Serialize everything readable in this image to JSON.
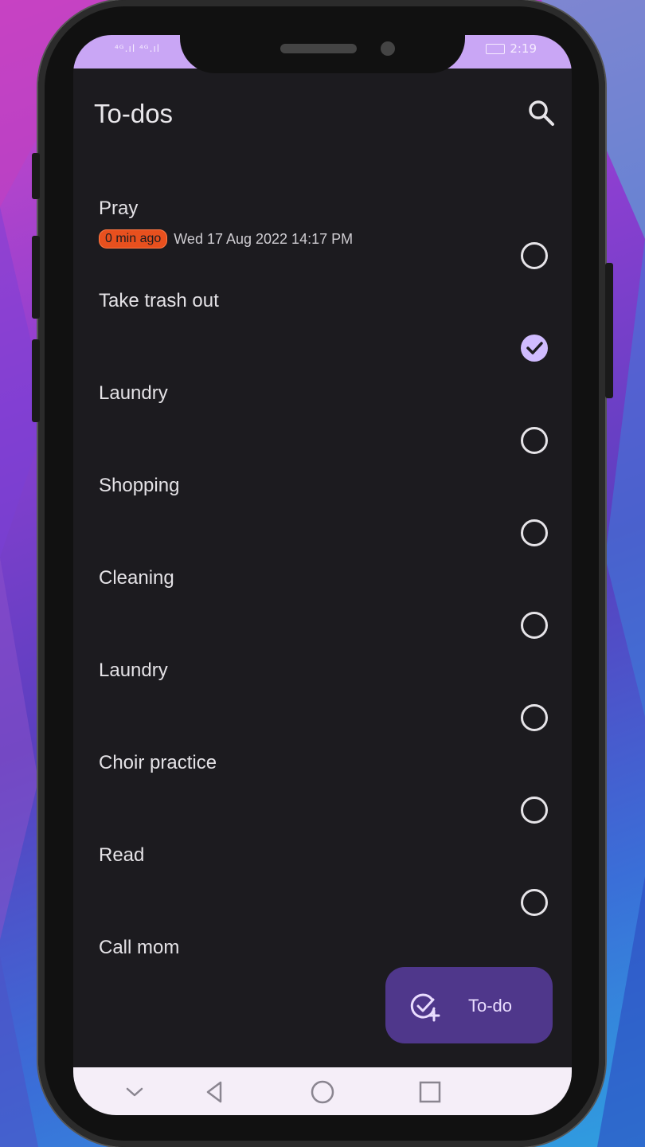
{
  "statusbar": {
    "left_icons": "⁴ᴳ.ıl ⁴ᴳ.ıl",
    "time": "2:19"
  },
  "appbar": {
    "title": "To-dos",
    "search_icon": "search-icon"
  },
  "todos": [
    {
      "title": "Pray",
      "badge": "0 min ago",
      "date": "Wed 17 Aug 2022 14:17 PM",
      "done": false
    },
    {
      "title": "Take trash out",
      "done": true
    },
    {
      "title": "Laundry",
      "done": false
    },
    {
      "title": "Shopping",
      "done": false
    },
    {
      "title": "Cleaning",
      "done": false
    },
    {
      "title": "Laundry",
      "done": false
    },
    {
      "title": "Choir practice",
      "done": false
    },
    {
      "title": "Read",
      "done": false
    },
    {
      "title": "Call mom",
      "done": false
    }
  ],
  "fab": {
    "label": "To-do",
    "icon": "add-task-icon"
  },
  "navbar": {
    "icons": [
      "chevron-down-icon",
      "back-icon",
      "home-icon",
      "recents-icon"
    ]
  },
  "colors": {
    "accent": "#d0bcff",
    "fab": "#4f378b",
    "badge": "#e8501e",
    "background": "#1c1b1f"
  }
}
